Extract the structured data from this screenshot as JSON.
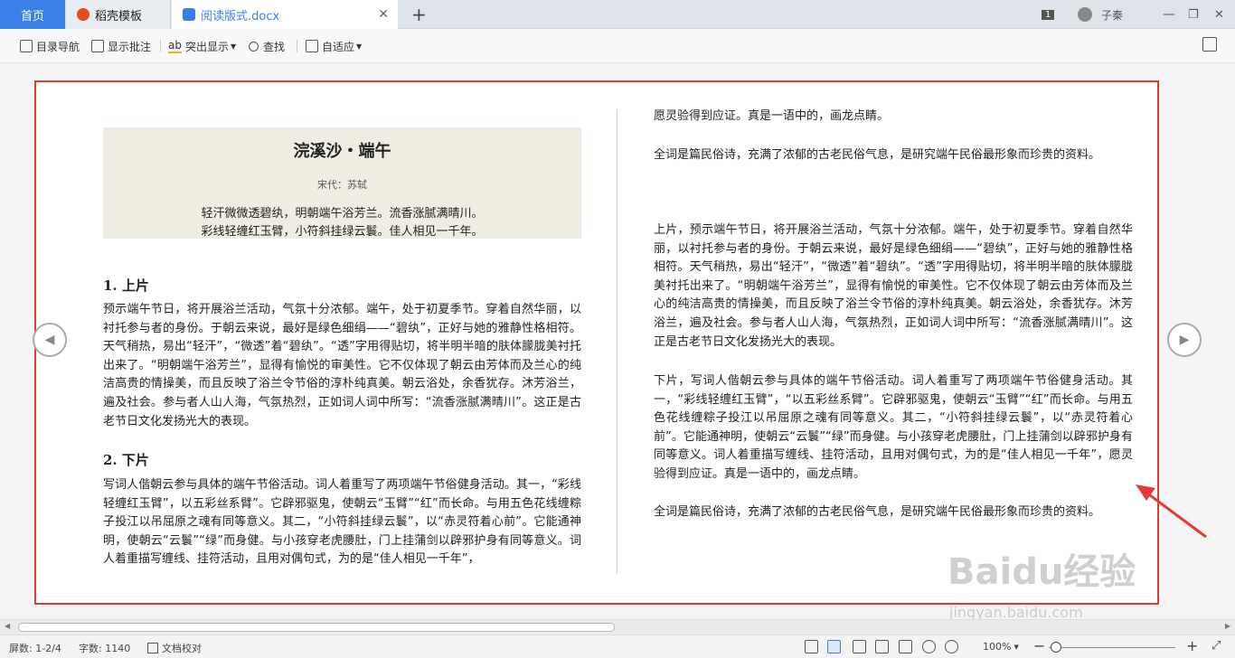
{
  "tabs": {
    "home": "首页",
    "daoke": "稻壳模板",
    "doc": "阅读版式.docx"
  },
  "window": {
    "count_badge": "1",
    "user": "子秦"
  },
  "toolbar": {
    "nav": "目录导航",
    "comments": "显示批注",
    "highlight": "突出显示",
    "find": "查找",
    "fit": "自适应"
  },
  "poem": {
    "title": "浣溪沙・端午",
    "author": "宋代：苏轼",
    "lines": [
      "轻汗微微透碧纨，明朝端午浴芳兰。流香涨腻满晴川。",
      "彩线轻缠红玉臂，小符斜挂绿云鬟。佳人相见一千年。"
    ]
  },
  "left": {
    "h1": "1.  上片",
    "p1": "预示端午节日，将开展浴兰活动，气氛十分浓郁。端午，处于初夏季节。穿着自然华丽，以衬托参与者的身份。于朝云来说，最好是绿色细绢——“碧纨”，正好与她的雅静性格相符。天气稍热，易出“轻汗”，“微透”着“碧纨”。“透”字用得贴切，将半明半暗的肤体朦胧美衬托出来了。“明朝端午浴芳兰”，显得有愉悦的审美性。它不仅体现了朝云由芳体而及兰心的纯洁高贵的情操美，而且反映了浴兰令节俗的淳朴纯真美。朝云浴处，余香犹存。沐芳浴兰，遍及社会。参与者人山人海，气氛热烈，正如词人词中所写：“流香涨腻满晴川”。这正是古老节日文化发扬光大的表现。",
    "h2": "2.  下片",
    "p2": "写词人偕朝云参与具体的端午节俗活动。词人着重写了两项端午节俗健身活动。其一，“彩线轻缠红玉臂”，以五彩丝系臂”。它辟邪驱鬼，使朝云“玉臂”“红”而长命。与用五色花线缠粽子投江以吊屈原之魂有同等意义。其二，“小符斜挂绿云鬟”，以“赤灵符着心前”。它能通神明，使朝云“云鬟”“绿”而身健。与小孩穿老虎腰肚，门上挂蒲剑以辟邪护身有同等意义。词人着重描写缠线、挂符活动，且用对偶句式，为的是“佳人相见一千年”，"
  },
  "right": {
    "p0": "愿灵验得到应证。真是一语中的，画龙点睛。",
    "p1": "全词是篇民俗诗，充满了浓郁的古老民俗气息，是研究端午民俗最形象而珍贵的资料。",
    "p2": "上片，预示端午节日，将开展浴兰活动，气氛十分浓郁。端午，处于初夏季节。穿着自然华丽，以衬托参与者的身份。于朝云来说，最好是绿色细绢——“碧纨”，正好与她的雅静性格相符。天气稍热，易出“轻汗”，“微透”着“碧纨”。“透”字用得贴切，将半明半暗的肤体朦胧美衬托出来了。“明朝端午浴芳兰”，显得有愉悦的审美性。它不仅体现了朝云由芳体而及兰心的纯洁高贵的情操美，而且反映了浴兰令节俗的淳朴纯真美。朝云浴处，余香犹存。沐芳浴兰，遍及社会。参与者人山人海，气氛热烈，正如词人词中所写：“流香涨腻满晴川”。这正是古老节日文化发扬光大的表现。",
    "p3": "下片，写词人偕朝云参与具体的端午节俗活动。词人着重写了两项端午节俗健身活动。其一，“彩线轻缠红玉臂”，“以五彩丝系臂”。它辟邪驱鬼，使朝云“玉臂”“红”而长命。与用五色花线缠粽子投江以吊屈原之魂有同等意义。其二，“小符斜挂绿云鬟”，以“赤灵符着心前”。它能通神明，使朝云“云鬟”“绿”而身健。与小孩穿老虎腰肚，门上挂蒲剑以辟邪护身有同等意义。词人着重描写缠线、挂符活动，且用对偶句式，为的是“佳人相见一千年”，愿灵验得到应证。真是一语中的，画龙点睛。",
    "p4": "全词是篇民俗诗，充满了浓郁的古老民俗气息，是研究端午民俗最形象而珍贵的资料。"
  },
  "status": {
    "screens": "屏数: 1-2/4",
    "words": "字数: 1140",
    "proof": "文档校对",
    "zoom": "100%",
    "zoom_out": "−",
    "zoom_in": "+"
  },
  "watermark": {
    "main": "Baidu经验",
    "sub": "jingyan.baidu.com"
  },
  "colors": {
    "accent": "#3a7ee8",
    "frame": "#e53935",
    "poem_bg": "#efede2"
  }
}
